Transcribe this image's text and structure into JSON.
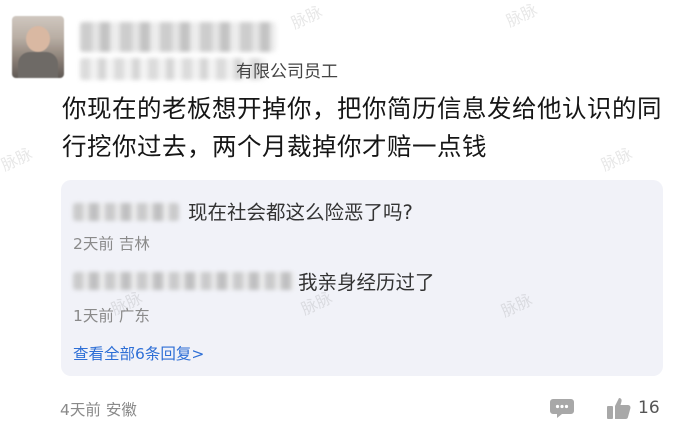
{
  "author": {
    "company_suffix": "有限公司员工"
  },
  "comment": {
    "text": "你现在的老板想开掉你，把你简历信息发给他认识的同行挖你过去，两个月裁掉你才赔一点钱",
    "time": "4天前",
    "location": "安徽",
    "likes": "16"
  },
  "replies": [
    {
      "text": "现在社会都这么险恶了吗?",
      "time": "2天前",
      "location": "吉林"
    },
    {
      "text": "我亲身经历过了",
      "time": "1天前",
      "location": "广东"
    }
  ],
  "view_all_label": "查看全部6条回复>",
  "watermark": "脉脉",
  "colors": {
    "link": "#2e6fd6",
    "reply_bg": "#f1f2f8",
    "meta": "#8a8a8a"
  }
}
